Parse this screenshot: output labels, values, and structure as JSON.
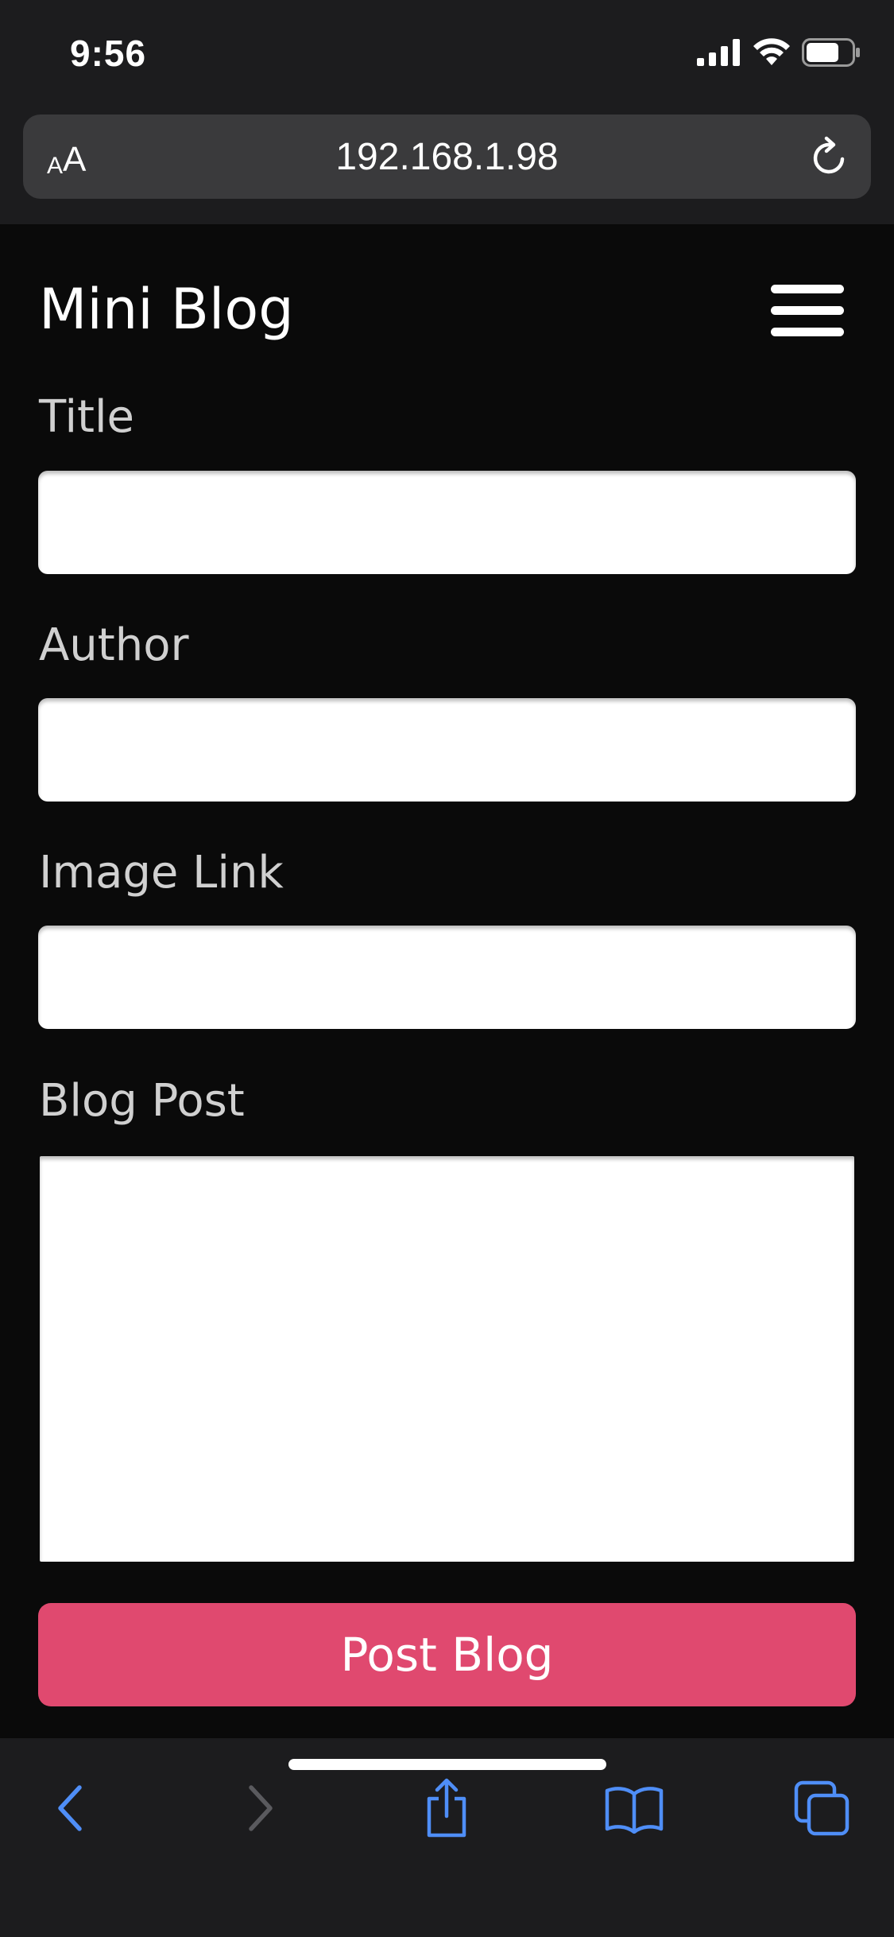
{
  "status_bar": {
    "time": "9:56"
  },
  "browser": {
    "text_size_small": "A",
    "text_size_large": "A",
    "url": "192.168.1.98"
  },
  "site": {
    "title": "Mini Blog"
  },
  "form": {
    "title_label": "Title",
    "title_value": "",
    "author_label": "Author",
    "author_value": "",
    "image_link_label": "Image Link",
    "image_link_value": "",
    "blog_post_label": "Blog Post",
    "blog_post_value": "",
    "submit_label": "Post Blog"
  },
  "toolbar": {
    "icons": [
      "back-icon",
      "forward-icon",
      "share-icon",
      "bookmarks-icon",
      "tabs-icon"
    ]
  },
  "colors": {
    "accent": "#e0496f",
    "browser_blue": "#4f8ef7",
    "background": "#0a0a0a",
    "chrome": "#1c1c1e"
  }
}
